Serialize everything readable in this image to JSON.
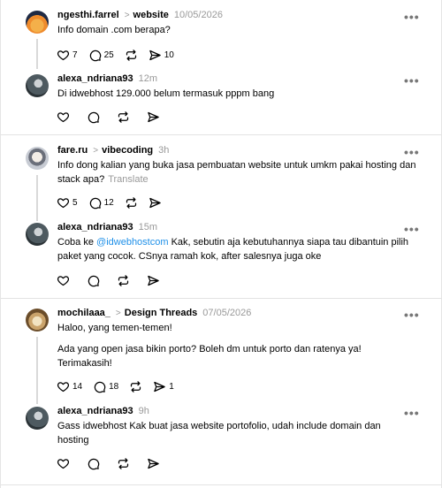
{
  "posts": [
    {
      "user": "ngesthi.farrel",
      "topic": "website",
      "time": "10/05/2026",
      "body": "Info domain .com berapa?",
      "stats": {
        "likes": "7",
        "replies": "25",
        "reposts": "",
        "shares": "10"
      },
      "reply": {
        "user": "alexa_ndriana93",
        "time": "12m",
        "body": "Di idwebhost 129.000 belum termasuk pppm bang"
      }
    },
    {
      "user": "fare.ru",
      "topic": "vibecoding",
      "time": "3h",
      "body": "Info dong kalian yang buka jasa pembuatan website untuk umkm pakai hosting dan stack apa?",
      "translate": "Translate",
      "stats": {
        "likes": "5",
        "replies": "12",
        "reposts": "",
        "shares": ""
      },
      "reply": {
        "user": "alexa_ndriana93",
        "time": "15m",
        "body_pre": "Coba ke ",
        "mention": "@idwebhostcom",
        "body_post": " Kak, sebutin aja kebutuhannya siapa tau dibantuin pilih paket yang cocok. CSnya ramah kok, after salesnya juga oke"
      }
    },
    {
      "user": "mochilaaa_",
      "topic": "Design Threads",
      "time": "07/05/2026",
      "body_p1": "Haloo, yang temen-temen!",
      "body_p2": "Ada yang open jasa bikin porto? Boleh dm untuk porto dan ratenya ya! Terimakasih!",
      "stats": {
        "likes": "14",
        "replies": "18",
        "reposts": "",
        "shares": "1"
      },
      "reply": {
        "user": "alexa_ndriana93",
        "time": "9h",
        "body": "Gass idwebhost Kak buat jasa website portofolio, udah include domain dan hosting"
      }
    }
  ],
  "icons": {
    "like": "heart-icon",
    "reply": "comment-icon",
    "repost": "repost-icon",
    "share": "send-icon",
    "more": "more-icon",
    "chevron": "chevron-right-icon"
  },
  "more_glyph": "•••",
  "chevron_glyph": ">"
}
